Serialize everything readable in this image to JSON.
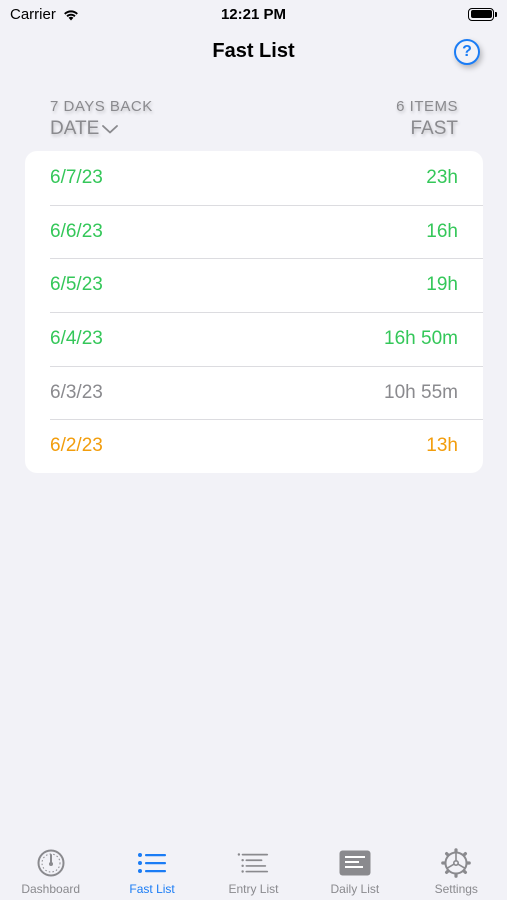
{
  "status_bar": {
    "carrier": "Carrier",
    "time": "12:21 PM"
  },
  "nav": {
    "title": "Fast List",
    "help_icon_text": "?"
  },
  "section": {
    "range_caption": "7 DAYS BACK",
    "count_caption": "6 ITEMS",
    "date_column": "DATE",
    "fast_column": "FAST"
  },
  "fasts": [
    {
      "date": "6/7/23",
      "duration": "23h",
      "color": "#34c759"
    },
    {
      "date": "6/6/23",
      "duration": "16h",
      "color": "#34c759"
    },
    {
      "date": "6/5/23",
      "duration": "19h",
      "color": "#34c759"
    },
    {
      "date": "6/4/23",
      "duration": "16h 50m",
      "color": "#34c759"
    },
    {
      "date": "6/3/23",
      "duration": "10h 55m",
      "color": "#8a8a8e"
    },
    {
      "date": "6/2/23",
      "duration": "13h",
      "color": "#f29d0c"
    }
  ],
  "tabs": [
    {
      "label": "Dashboard",
      "icon": "gauge-icon",
      "active": false
    },
    {
      "label": "Fast List",
      "icon": "list-icon",
      "active": true
    },
    {
      "label": "Entry List",
      "icon": "entry-list-icon",
      "active": false
    },
    {
      "label": "Daily List",
      "icon": "daily-list-icon",
      "active": false
    },
    {
      "label": "Settings",
      "icon": "gear-icon",
      "active": false
    }
  ],
  "colors": {
    "accent": "#1a7cf5",
    "background": "#f2f2f7",
    "secondary_text": "#8a8a8e"
  }
}
